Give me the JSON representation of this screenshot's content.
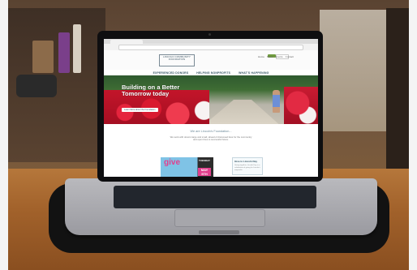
{
  "site": {
    "logo": "LINCOLN COMMUNITY FOUNDATION",
    "top_links": [
      "Home",
      "News",
      "Events",
      "Contact"
    ],
    "nav": [
      "EXPERIENCED DONORS",
      "HELPING NONPROFITS",
      "WHAT'S HAPPENING"
    ],
    "hero_title": "Building on a Better Tomorrow today",
    "hero_button": "Learn More about the Foundation",
    "intro_heading": "We are Lincoln's Foundation...",
    "intro_text": "We work with donors large and small, ahead of discussed lives for the community and open lines to successful future.",
    "give_card": {
      "give": "give",
      "tuesday": "TUESDAY",
      "may": "MAY 5TH"
    },
    "guide_card": {
      "title": "Give to Lincoln Day",
      "text": "Giving together, Lincoln Day is a celebration of giving for Lincoln's nonprofits."
    }
  },
  "colors": {
    "nav_text": "#355564",
    "donate_button": "#6f9a3e",
    "hero_flowers": "#d9192f",
    "give_pink": "#e23f8d"
  }
}
